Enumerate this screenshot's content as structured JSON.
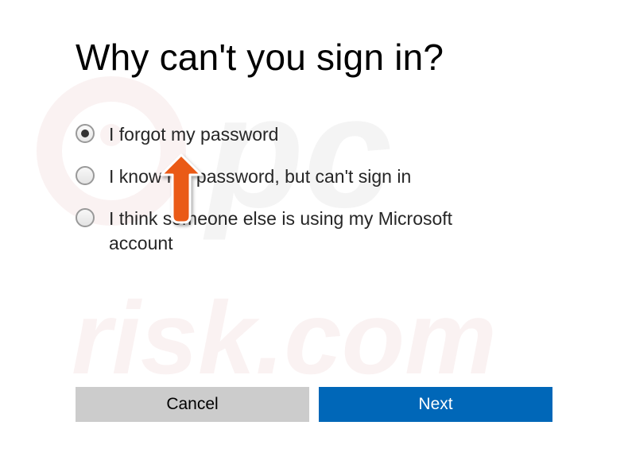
{
  "title": "Why can't you sign in?",
  "options": [
    {
      "label": "I forgot my password",
      "selected": true
    },
    {
      "label": "I know my password, but can't sign in",
      "selected": false
    },
    {
      "label": "I think someone else is using my Microsoft account",
      "selected": false
    }
  ],
  "buttons": {
    "cancel": "Cancel",
    "next": "Next"
  },
  "watermark_text_top": "pc",
  "watermark_text_bottom": "risk.com"
}
